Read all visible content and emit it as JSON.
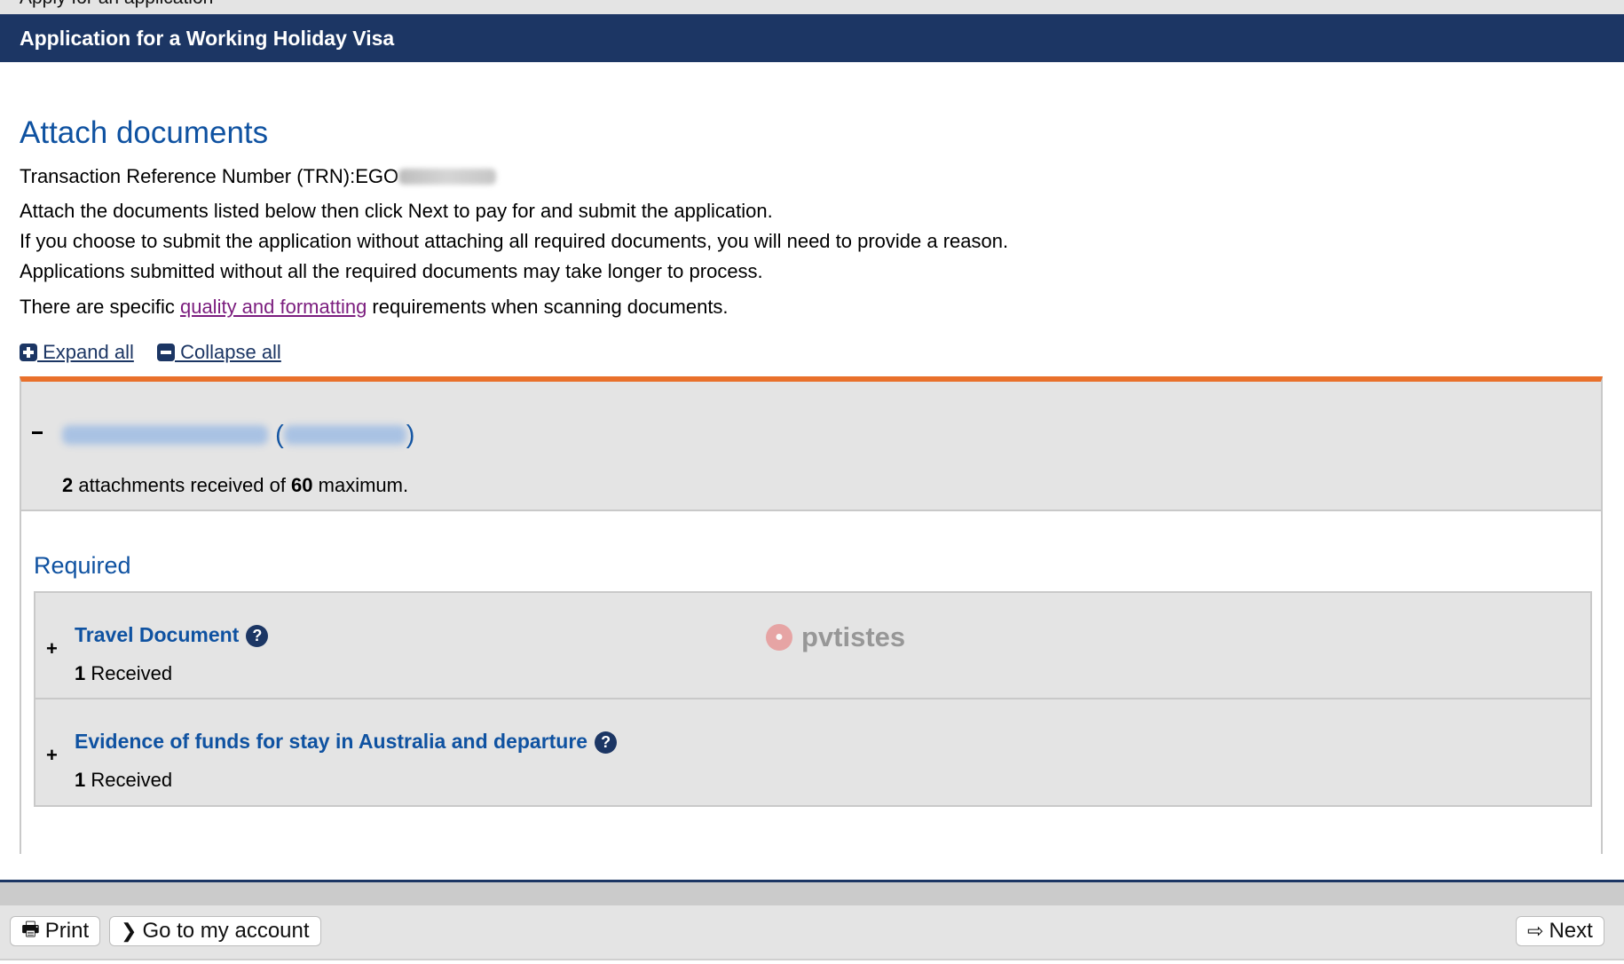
{
  "top_strip": {
    "partial_text": "Apply for an application"
  },
  "header": {
    "title": "Application for a Working Holiday Visa"
  },
  "page": {
    "title": "Attach documents",
    "trn_label": "Transaction Reference Number (TRN):EGO",
    "instructions": [
      "Attach the documents listed below then click Next to pay for and submit the application.",
      "If you choose to submit the application without attaching all required documents, you will need to provide a reason.",
      "Applications submitted without all the required documents may take longer to process."
    ],
    "quality_prefix": "There are specific ",
    "quality_link": "quality and formatting",
    "quality_suffix": " requirements when scanning documents."
  },
  "toggles": {
    "expand_all": " Expand all",
    "collapse_all": " Collapse all"
  },
  "applicant": {
    "paren_open": "(",
    "paren_close": ")",
    "received_count": "2",
    "received_mid": " attachments received of ",
    "max_count": "60",
    "received_end": " maximum."
  },
  "required_section": {
    "title": "Required",
    "items": [
      {
        "title": "Travel Document",
        "count": "1",
        "status": " Received"
      },
      {
        "title": "Evidence of funds for stay in Australia and departure",
        "count": "1",
        "status": " Received"
      }
    ]
  },
  "watermark": {
    "text": "pvtistes"
  },
  "footer": {
    "print": "Print",
    "account": "Go to my account",
    "next": "Next"
  },
  "colors": {
    "navy": "#1c3664",
    "accent_orange": "#e9702b",
    "link_blue": "#0f52a1",
    "visited_link": "#7b1d7e"
  }
}
